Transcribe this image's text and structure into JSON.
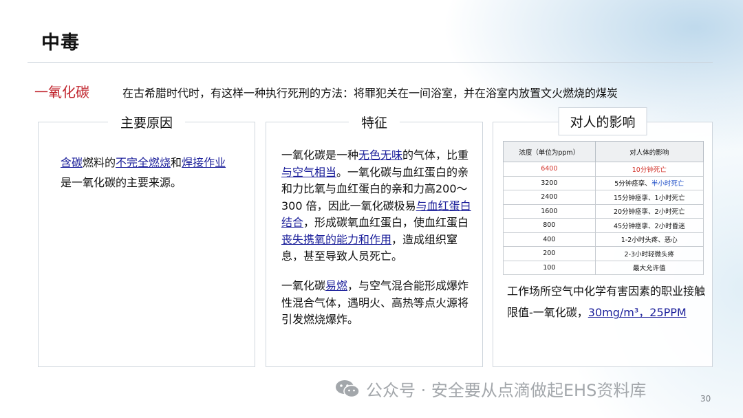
{
  "title": "中毒",
  "subject": "一氧化碳",
  "intro": "在古希腊时代时，有这样一种执行死刑的方法：将罪犯关在一间浴室，并在浴室内放置文火燃烧的煤炭",
  "panels": {
    "causes": {
      "heading": "主要原因",
      "parts": [
        {
          "text": "含碳",
          "hl": true
        },
        {
          "text": "燃料的",
          "hl": false
        },
        {
          "text": "不完全燃烧",
          "hl": true
        },
        {
          "text": "和",
          "hl": false
        },
        {
          "text": "焊接作业",
          "hl": true
        },
        {
          "text": "是一氧化碳的主要来源。",
          "hl": false
        }
      ]
    },
    "features": {
      "heading": "特征",
      "para1": [
        {
          "text": "一氧化碳是一种",
          "hl": false
        },
        {
          "text": "无色无味",
          "hl": true
        },
        {
          "text": "的气体，比重",
          "hl": false
        },
        {
          "text": "与空气相当",
          "hl": true
        },
        {
          "text": "。一氧化碳与血红蛋白的亲和力比氧与血红蛋白的亲和力高200～300 倍，因此一氧化碳极易",
          "hl": false
        },
        {
          "text": "与血红蛋白结合",
          "hl": true
        },
        {
          "text": "，形成碳氧血红蛋白，使血红蛋白",
          "hl": false
        },
        {
          "text": "丧失携氧的能力和作用",
          "hl": true
        },
        {
          "text": "，造成组织窒息，甚至导致人员死亡。",
          "hl": false
        }
      ],
      "para2": [
        {
          "text": "一氧化碳",
          "hl": false
        },
        {
          "text": "易燃",
          "hl": true
        },
        {
          "text": "，与空气混合能形成爆炸性混合气体，遇明火、高热等点火源将引发燃烧爆炸。",
          "hl": false
        }
      ]
    },
    "effects": {
      "heading": "对人的影响",
      "table": {
        "headers": [
          "浓度（单位为ppm）",
          "对人体的影响"
        ],
        "rows": [
          {
            "conc": "6400",
            "effect_pre": "",
            "effect_hl": "10分钟死亡",
            "conc_red": true
          },
          {
            "conc": "3200",
            "effect_pre": "5分钟痉挛、",
            "effect_hl": "半小时死亡",
            "conc_red": false
          },
          {
            "conc": "2400",
            "effect_pre": "15分钟痉挛、1小时死亡",
            "effect_hl": "",
            "conc_red": false
          },
          {
            "conc": "1600",
            "effect_pre": "20分钟痉挛、2小时死亡",
            "effect_hl": "",
            "conc_red": false
          },
          {
            "conc": "800",
            "effect_pre": "45分钟痉挛、2小时昏迷",
            "effect_hl": "",
            "conc_red": false
          },
          {
            "conc": "400",
            "effect_pre": "1-2小时头疼、恶心",
            "effect_hl": "",
            "conc_red": false
          },
          {
            "conc": "200",
            "effect_pre": "2-3小时轻微头疼",
            "effect_hl": "",
            "conc_red": false
          },
          {
            "conc": "100",
            "effect_pre": "最大允许值",
            "effect_hl": "",
            "conc_red": false
          }
        ]
      },
      "oel_text": "工作场所空气中化学有害因素的职业接触限值-一氧化碳，",
      "oel_values": "30mg/m³，25PPM"
    }
  },
  "watermark": "公众号 · 安全要从点滴做起EHS资料库",
  "page_number": "30",
  "colors": {
    "title_red": "#c0232c",
    "highlight_blue": "#1a1e9a",
    "table_red": "#d2322a",
    "table_blue": "#2050c8",
    "watermark_gray": "#a3a7ab"
  },
  "icons": {
    "watermark": "wechat-icon"
  }
}
